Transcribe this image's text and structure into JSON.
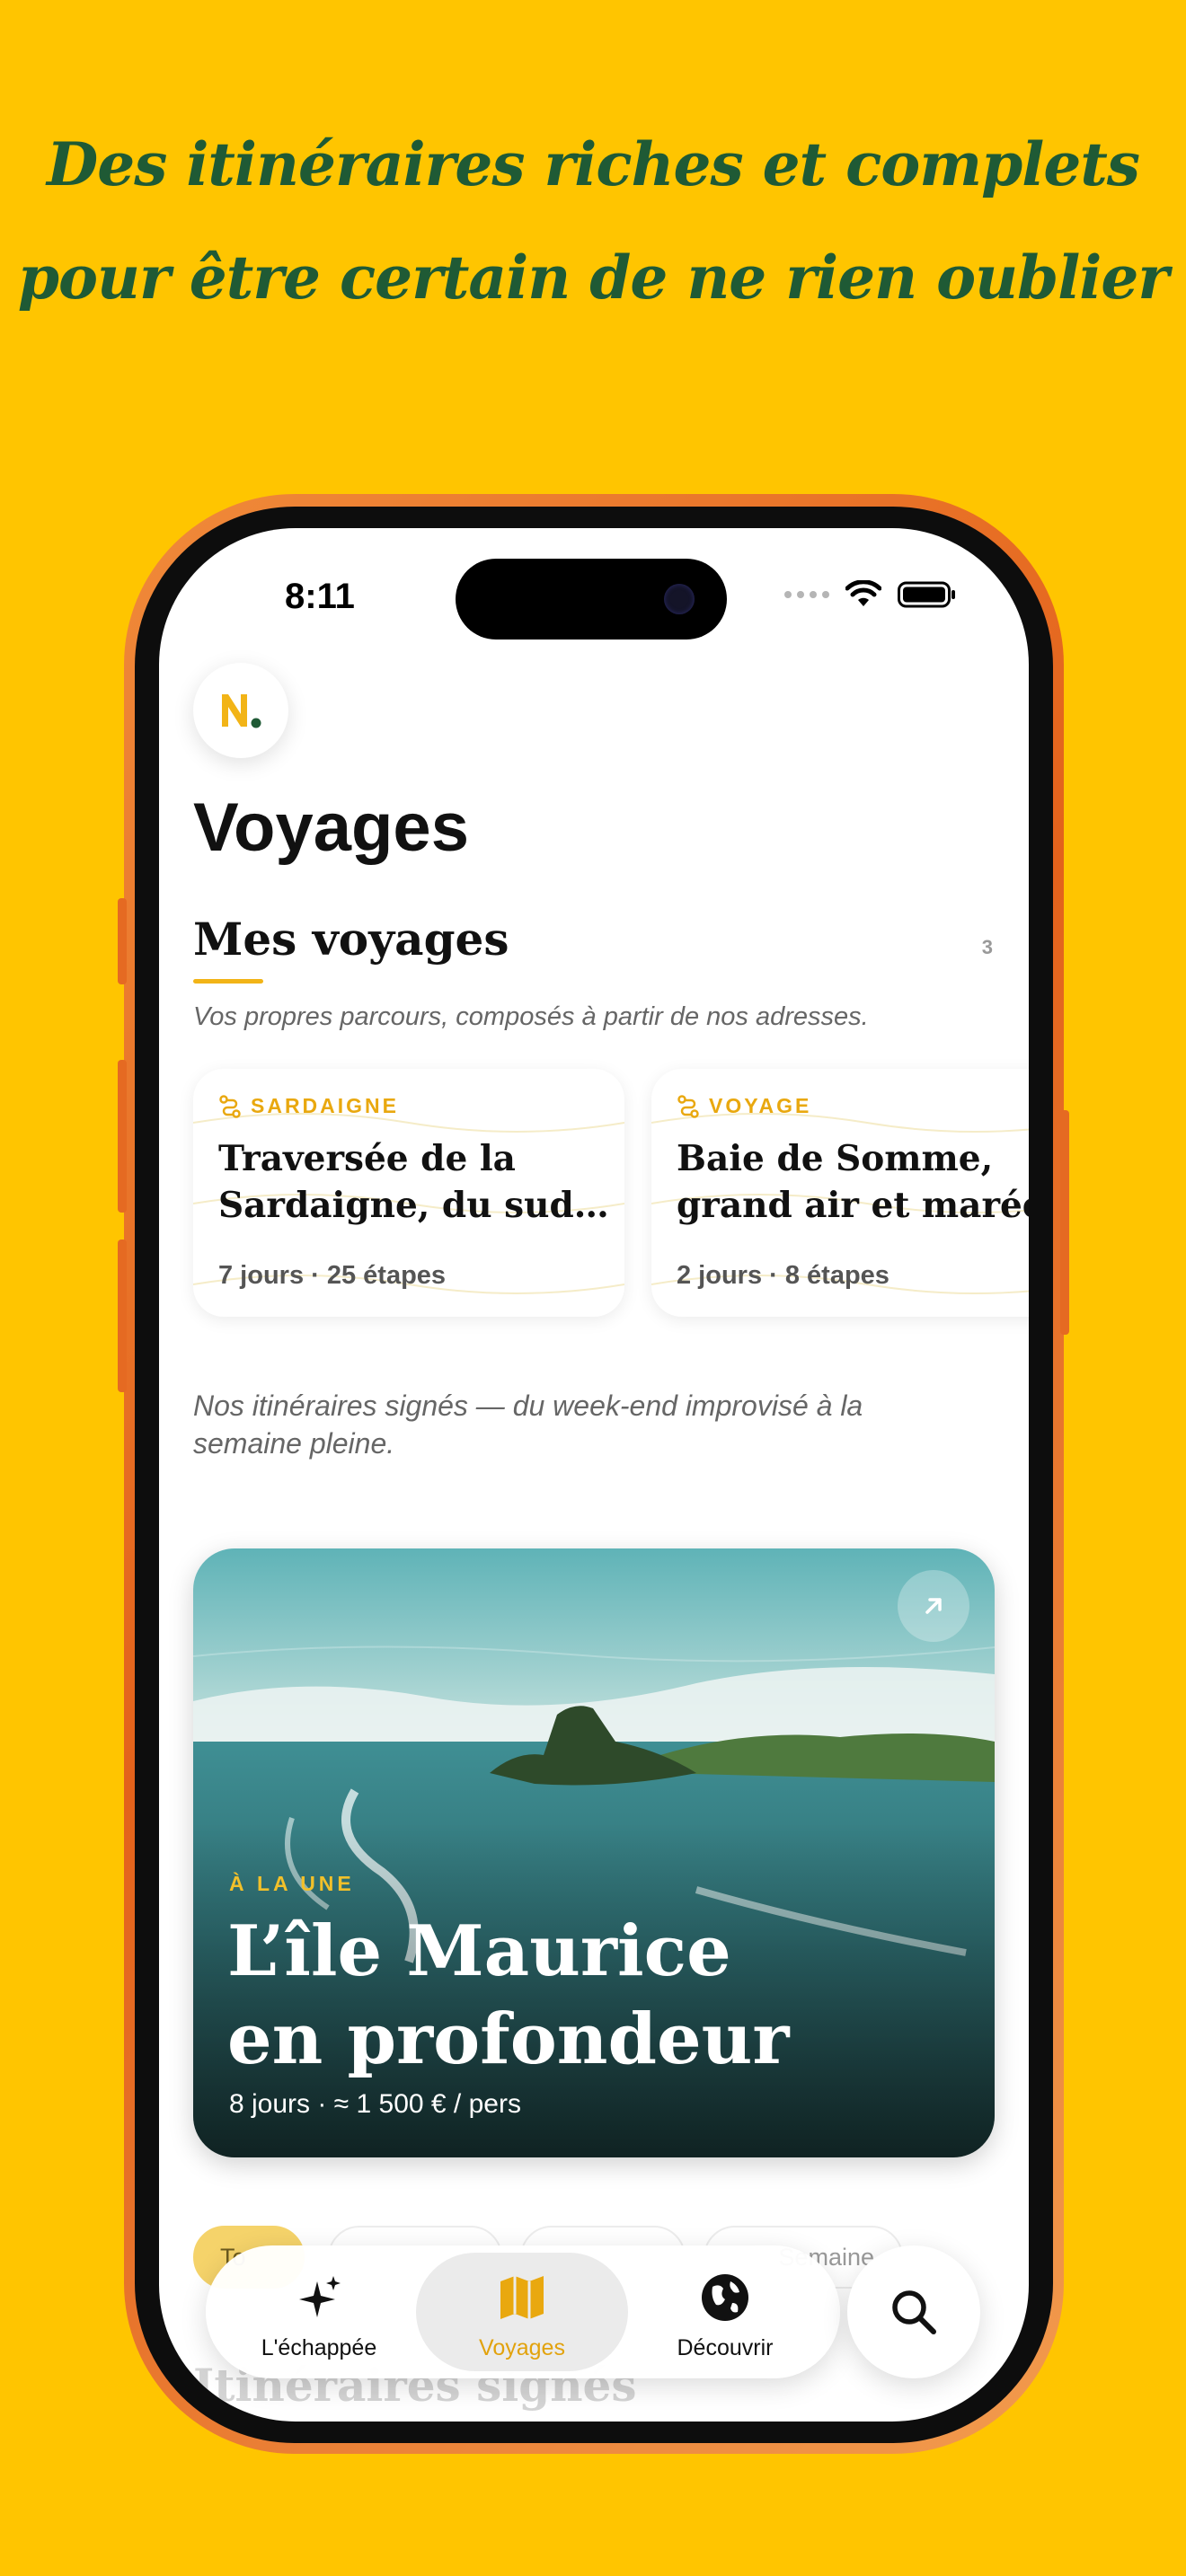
{
  "marketing": {
    "line1": "Des itinéraires riches et complets",
    "line2": "pour être certain de ne rien oublier"
  },
  "status_bar": {
    "time": "8:11"
  },
  "page": {
    "title": "Voyages"
  },
  "my_trips": {
    "title": "Mes voyages",
    "count": "3",
    "subtitle": "Vos propres parcours, composés à partir de nos adresses.",
    "cards": [
      {
        "tag": "SARDAIGNE",
        "title_l1": "Traversée de la",
        "title_l2": "Sardaigne, du sud…",
        "meta": "7 jours · 25 étapes"
      },
      {
        "tag": "VOYAGE",
        "title_l1": "Baie de Somme,",
        "title_l2": "grand air et marées",
        "meta": "2 jours · 8 étapes"
      }
    ]
  },
  "signed": {
    "intro": "Nos itinéraires signés — du week-end improvisé à la semaine pleine.",
    "featured": {
      "tag": "À LA UNE",
      "title_l1": "L’île Maurice",
      "title_l2": "en profondeur",
      "meta": "8 jours · ≈ 1 500 € / pers"
    },
    "filters": [
      "To",
      "",
      "",
      "Semaine"
    ],
    "section_title": "Itinéraires signés"
  },
  "tabs": [
    {
      "label": "L'échappée",
      "icon": "sparkles-icon"
    },
    {
      "label": "Voyages",
      "icon": "map-icon"
    },
    {
      "label": "Découvrir",
      "icon": "globe-icon"
    }
  ],
  "colors": {
    "background": "#FFC500",
    "accent": "#E9A80F",
    "headline": "#1F5A35"
  }
}
